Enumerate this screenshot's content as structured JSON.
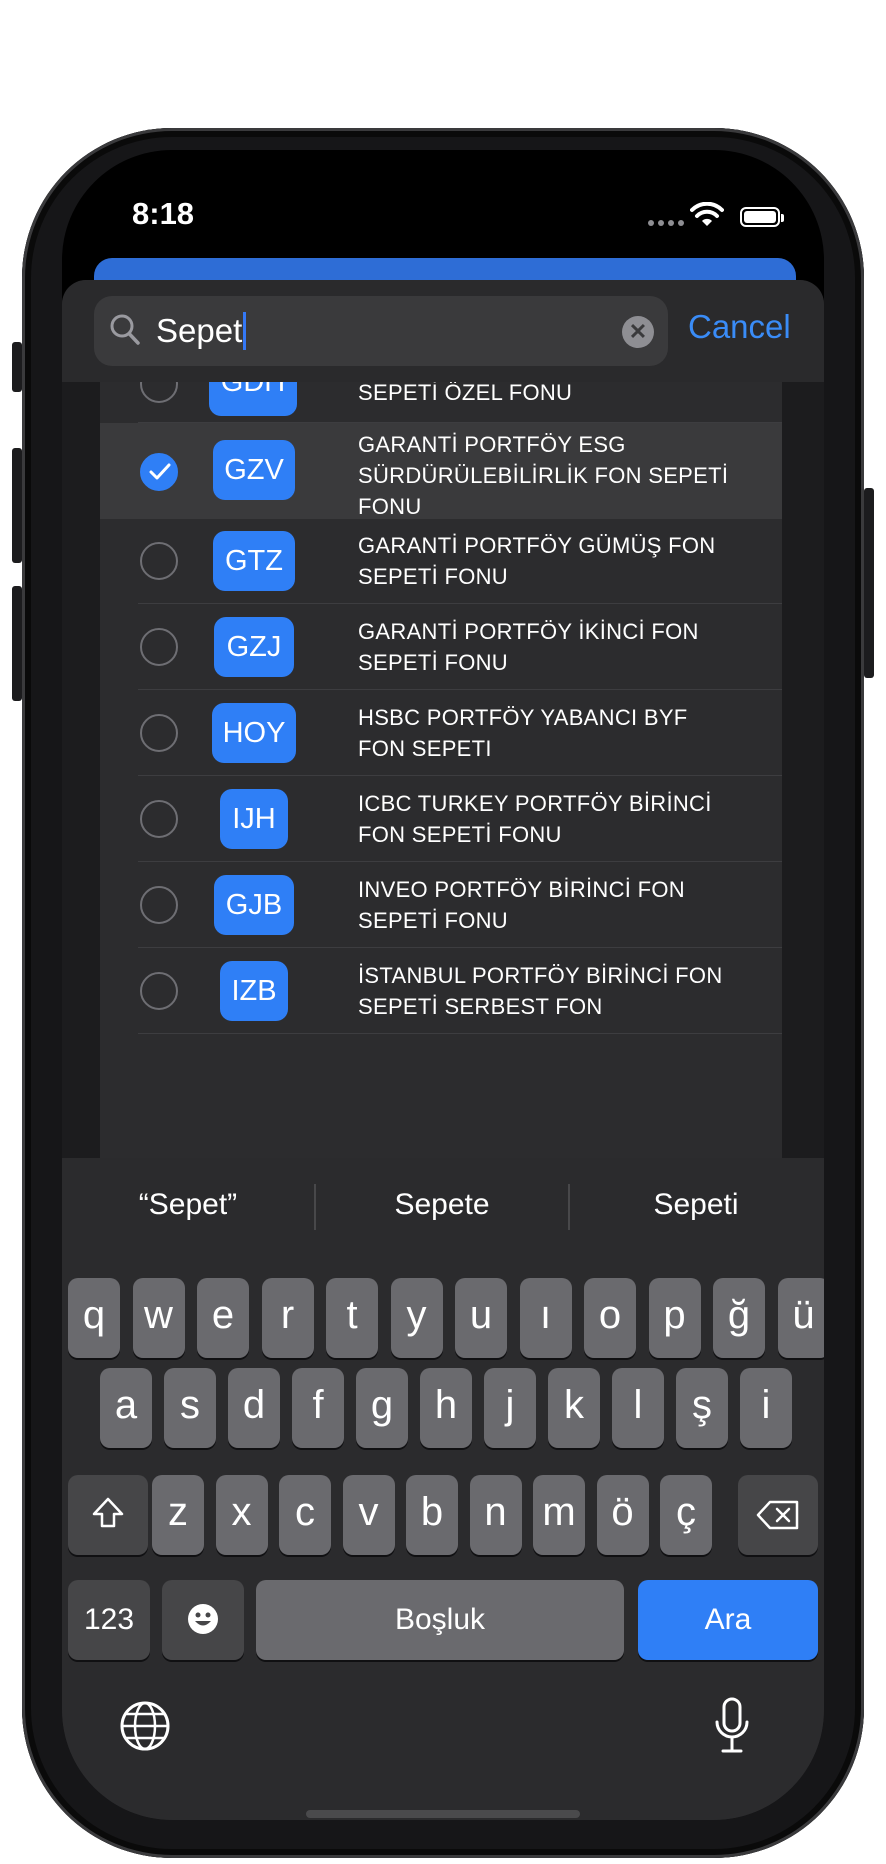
{
  "status_bar": {
    "time": "8:18"
  },
  "search": {
    "query": "Sepet",
    "cancel_label": "Cancel"
  },
  "partial_row": {
    "code": "GDH",
    "name": "SEPETİ ÖZEL FONU"
  },
  "funds": [
    {
      "code": "GZV",
      "name": "GARANTİ PORTFÖY ESG SÜRDÜRÜLEBİLİRLİK FON SEPETİ FONU",
      "selected": true
    },
    {
      "code": "GTZ",
      "name": "GARANTİ PORTFÖY GÜMÜŞ FON SEPETİ FONU",
      "selected": false
    },
    {
      "code": "GZJ",
      "name": "GARANTİ PORTFÖY İKİNCİ FON SEPETİ FONU",
      "selected": false
    },
    {
      "code": "HOY",
      "name": "HSBC PORTFÖY YABANCI BYF FON SEPETI",
      "selected": false
    },
    {
      "code": "IJH",
      "name": "ICBC TURKEY PORTFÖY BİRİNCİ FON SEPETİ FONU",
      "selected": false
    },
    {
      "code": "GJB",
      "name": "INVEO PORTFÖY BİRİNCİ FON SEPETİ FONU",
      "selected": false
    },
    {
      "code": "IZB",
      "name": "İSTANBUL PORTFÖY BİRİNCİ FON SEPETİ SERBEST FON",
      "selected": false
    }
  ],
  "keyboard": {
    "suggestions": [
      "“Sepet”",
      "Sepete",
      "Sepeti"
    ],
    "row1": [
      "q",
      "w",
      "e",
      "r",
      "t",
      "y",
      "u",
      "ı",
      "o",
      "p",
      "ğ",
      "ü"
    ],
    "row2": [
      "a",
      "s",
      "d",
      "f",
      "g",
      "h",
      "j",
      "k",
      "l",
      "ş",
      "i"
    ],
    "row3": [
      "z",
      "x",
      "c",
      "v",
      "b",
      "n",
      "m",
      "ö",
      "ç"
    ],
    "numbers_label": "123",
    "space_label": "Boşluk",
    "return_label": "Ara"
  },
  "colors": {
    "accent": "#2f7ff6",
    "link": "#3a8cf7",
    "sheet": "#1c1c1e"
  }
}
